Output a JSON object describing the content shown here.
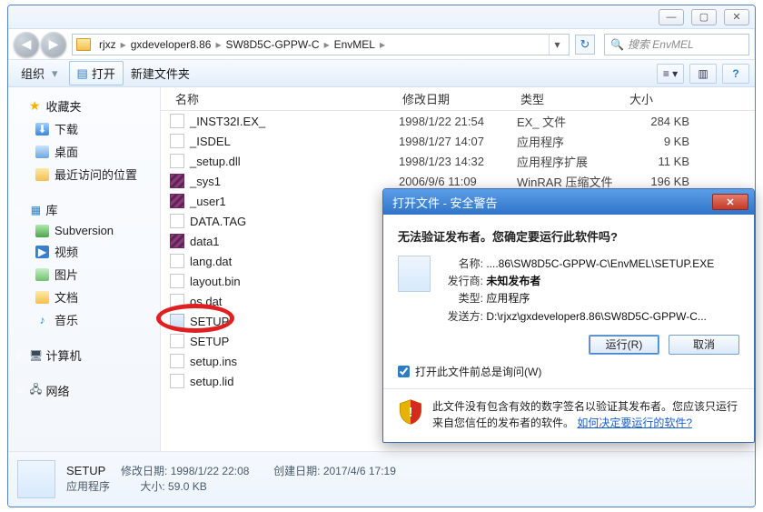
{
  "sysbtns": {
    "min": "—",
    "max": "▢",
    "close": "✕"
  },
  "breadcrumbs": [
    "rjxz",
    "gxdeveloper8.86",
    "SW8D5C-GPPW-C",
    "EnvMEL"
  ],
  "search": {
    "placeholder": "搜索 EnvMEL"
  },
  "toolbar": {
    "organize": "组织",
    "open": "打开",
    "newfolder": "新建文件夹"
  },
  "sidebar": {
    "fav": "收藏夹",
    "downloads": "下载",
    "desktop": "桌面",
    "recent": "最近访问的位置",
    "lib": "库",
    "svn": "Subversion",
    "video": "视频",
    "pics": "图片",
    "docs": "文档",
    "music": "音乐",
    "computer": "计算机",
    "network": "网络"
  },
  "columns": {
    "name": "名称",
    "date": "修改日期",
    "type": "类型",
    "size": "大小"
  },
  "files": [
    {
      "icon": "file",
      "name": "_INST32I.EX_",
      "date": "1998/1/22 21:54",
      "type": "EX_ 文件",
      "size": "284 KB"
    },
    {
      "icon": "file",
      "name": "_ISDEL",
      "date": "1998/1/27 14:07",
      "type": "应用程序",
      "size": "9 KB"
    },
    {
      "icon": "file",
      "name": "_setup.dll",
      "date": "1998/1/23 14:32",
      "type": "应用程序扩展",
      "size": "11 KB"
    },
    {
      "icon": "rar",
      "name": "_sys1",
      "date": "2006/9/6 11:09",
      "type": "WinRAR 压缩文件",
      "size": "196 KB"
    },
    {
      "icon": "rar",
      "name": "_user1",
      "date": "",
      "type": "",
      "size": ""
    },
    {
      "icon": "file",
      "name": "DATA.TAG",
      "date": "",
      "type": "",
      "size": ""
    },
    {
      "icon": "rar",
      "name": "data1",
      "date": "",
      "type": "",
      "size": ""
    },
    {
      "icon": "file",
      "name": "lang.dat",
      "date": "",
      "type": "",
      "size": ""
    },
    {
      "icon": "file",
      "name": "layout.bin",
      "date": "",
      "type": "",
      "size": ""
    },
    {
      "icon": "file",
      "name": "os.dat",
      "date": "",
      "type": "",
      "size": ""
    },
    {
      "icon": "exe",
      "name": "SETUP",
      "date": "",
      "type": "",
      "size": ""
    },
    {
      "icon": "file",
      "name": "SETUP",
      "date": "",
      "type": "",
      "size": ""
    },
    {
      "icon": "file",
      "name": "setup.ins",
      "date": "",
      "type": "",
      "size": ""
    },
    {
      "icon": "file",
      "name": "setup.lid",
      "date": "",
      "type": "",
      "size": ""
    }
  ],
  "details": {
    "name": "SETUP",
    "mod_label": "修改日期:",
    "mod": "1998/1/22 22:08",
    "create_label": "创建日期:",
    "create": "2017/4/6 17:19",
    "type": "应用程序",
    "size_label": "大小:",
    "size": "59.0 KB"
  },
  "dialog": {
    "title": "打开文件 - 安全警告",
    "question": "无法验证发布者。您确定要运行此软件吗?",
    "name_label": "名称:",
    "name_value": "....86\\SW8D5C-GPPW-C\\EnvMEL\\SETUP.EXE",
    "publisher_label": "发行商:",
    "publisher_value": "未知发布者",
    "type_label": "类型:",
    "type_value": "应用程序",
    "from_label": "发送方:",
    "from_value": "D:\\rjxz\\gxdeveloper8.86\\SW8D5C-GPPW-C...",
    "run": "运行(R)",
    "cancel": "取消",
    "ask": "打开此文件前总是询问(W)",
    "warn1": "此文件没有包含有效的数字签名以验证其发布者。您应该只运行来自您信任的发布者的软件。",
    "warn_link": "如何决定要运行的软件?"
  }
}
